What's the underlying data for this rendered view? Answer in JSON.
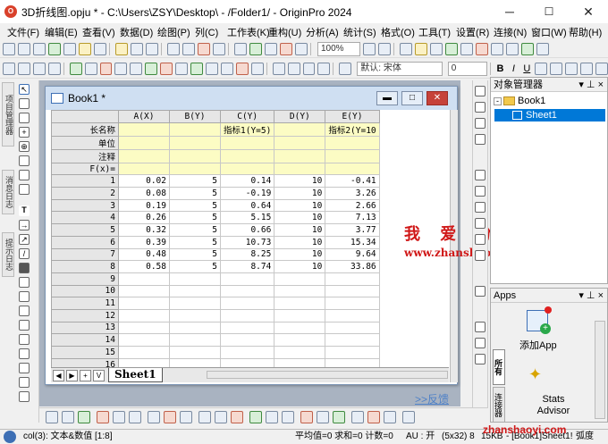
{
  "window": {
    "title": "3D折线图.opju * - C:\\Users\\ZSY\\Desktop\\ - /Folder1/ - OriginPro 2024",
    "minimize": "─",
    "maximize": "☐",
    "close": "✕"
  },
  "menu": [
    "文件(F)",
    "编辑(E)",
    "查看(V)",
    "数据(D)",
    "绘图(P)",
    "列(C)",
    "工作表(K)",
    "重构(U)",
    "分析(A)",
    "统计(S)",
    "格式(O)",
    "工具(T)",
    "设置(R)",
    "连接(N)",
    "窗口(W)",
    "帮助(H)"
  ],
  "toolbar": {
    "zoom": "100%",
    "font": "默认: 宋体",
    "font_size": "0",
    "bold": "B",
    "italic": "I",
    "underline": "U"
  },
  "left_tabs": [
    "消息日志",
    "提示日志",
    "项目管理器"
  ],
  "book": {
    "title": "Book1 *"
  },
  "sheet": {
    "columns": [
      "A(X)",
      "B(Y)",
      "C(Y)",
      "D(Y)",
      "E(Y)"
    ],
    "meta_labels": [
      "长名称",
      "单位",
      "注释",
      "F(x)="
    ],
    "long_names": [
      "",
      "",
      "指标1(Y=5)",
      "",
      "指标2(Y=10"
    ],
    "rows": [
      [
        "1",
        "0.02",
        "5",
        "0.14",
        "10",
        "-0.41"
      ],
      [
        "2",
        "0.08",
        "5",
        "-0.19",
        "10",
        "3.26"
      ],
      [
        "3",
        "0.19",
        "5",
        "0.64",
        "10",
        "2.66"
      ],
      [
        "4",
        "0.26",
        "5",
        "5.15",
        "10",
        "7.13"
      ],
      [
        "5",
        "0.32",
        "5",
        "0.66",
        "10",
        "3.77"
      ],
      [
        "6",
        "0.39",
        "5",
        "10.73",
        "10",
        "15.34"
      ],
      [
        "7",
        "0.48",
        "5",
        "8.25",
        "10",
        "9.64"
      ],
      [
        "8",
        "0.58",
        "5",
        "8.74",
        "10",
        "33.86"
      ],
      [
        "9",
        "",
        "",
        "",
        "",
        ""
      ],
      [
        "10",
        "",
        "",
        "",
        "",
        ""
      ],
      [
        "11",
        "",
        "",
        "",
        "",
        ""
      ],
      [
        "12",
        "",
        "",
        "",
        "",
        ""
      ],
      [
        "13",
        "",
        "",
        "",
        "",
        ""
      ],
      [
        "14",
        "",
        "",
        "",
        "",
        ""
      ],
      [
        "15",
        "",
        "",
        "",
        "",
        ""
      ],
      [
        "16",
        "",
        "",
        "",
        "",
        ""
      ]
    ],
    "tab_name": "Sheet1"
  },
  "feedback": ">>反馈",
  "watermark": {
    "line1": "我 爱 分 享 网",
    "line2": "www.zhanshaoyi.com"
  },
  "object_manager": {
    "title": "对象管理器",
    "book": "Book1",
    "sheet": "Sheet1"
  },
  "apps": {
    "title": "Apps",
    "tabs": [
      "所有",
      "连接器"
    ],
    "items": [
      "添加App",
      "Stats Advisor"
    ]
  },
  "status": {
    "left": "col(3): 文本&数值 [1:8]",
    "stats": "平均值=0 求和=0 计数=0",
    "au": "AU : 开",
    "dims": "(5x32) 8",
    "size": "15KB",
    "path": "- [Book1]Sheet1!",
    "unit": "弧度",
    "watermark_small": "zhanshaoyi.com"
  }
}
